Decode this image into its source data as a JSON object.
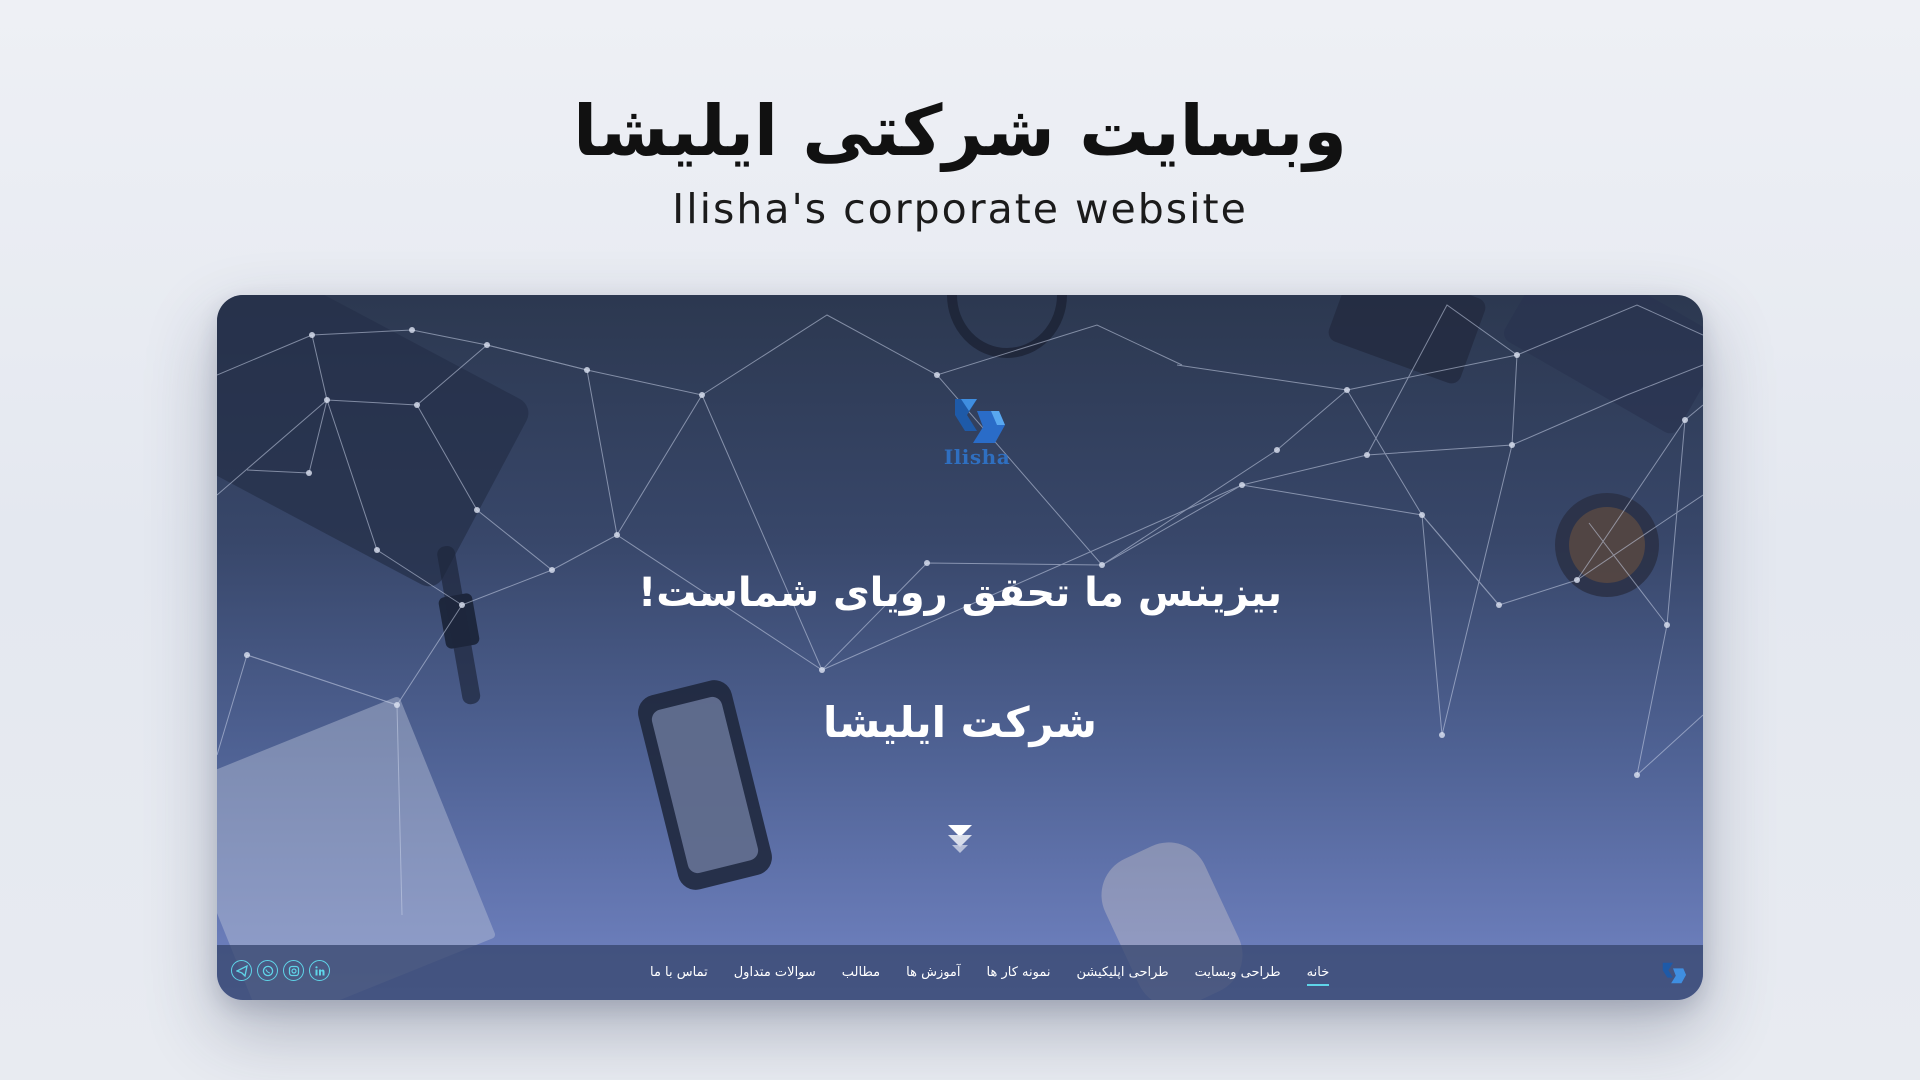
{
  "page": {
    "title_fa": "وبسایت شرکتی ایلیشا",
    "title_en": "Ilisha's corporate website"
  },
  "hero": {
    "logo_text": "Ilisha",
    "headline": "بیزینس ما تحقق رویای شماست!",
    "company": "شرکت ایلیشا"
  },
  "nav": {
    "items": [
      {
        "label": "خانه",
        "active": true
      },
      {
        "label": "طراحی وبسایت",
        "active": false
      },
      {
        "label": "طراحی اپلیکیشن",
        "active": false
      },
      {
        "label": "نمونه کار ها",
        "active": false
      },
      {
        "label": "آموزش ها",
        "active": false
      },
      {
        "label": "مطالب",
        "active": false
      },
      {
        "label": "سوالات متداول",
        "active": false
      },
      {
        "label": "تماس با ما",
        "active": false
      }
    ],
    "socials": [
      "linkedin-icon",
      "instagram-icon",
      "whatsapp-icon",
      "telegram-icon"
    ]
  },
  "colors": {
    "accent": "#5fd4e8",
    "logo_blue": "#2f6fc0",
    "card_top": "#2c3850",
    "card_bottom": "#7284c4"
  }
}
